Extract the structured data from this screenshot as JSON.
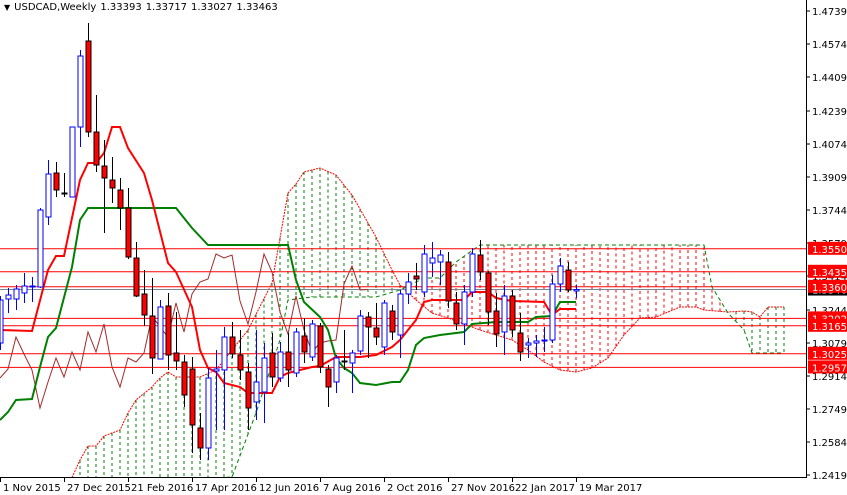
{
  "header": {
    "symbol_label": "USDCAD,Weekly",
    "open": "1.33393",
    "high": "1.33717",
    "low": "1.33027",
    "close": "1.33463"
  },
  "colors": {
    "bull": "#0000ff",
    "bear": "#ff0000",
    "tenkan": "#ff0000",
    "kijun": "#008000",
    "chikou": "#a52a2a",
    "span_a": "#ff0000",
    "span_b": "#008000",
    "level": "#ff0000",
    "current": "#778899"
  },
  "chart_data": {
    "type": "candlestick",
    "title": "USDCAD,Weekly",
    "ylim": [
      1.2419,
      1.4739
    ],
    "price_ticks": [
      "1.47390",
      "1.45740",
      "1.44090",
      "1.42390",
      "1.40740",
      "1.39090",
      "1.37440",
      "1.35790",
      "1.34140",
      "1.32440",
      "1.30790",
      "1.29140",
      "1.27490",
      "1.25840",
      "1.24190"
    ],
    "date_ticks": [
      {
        "bar": 0,
        "label": "1 Nov 2015"
      },
      {
        "bar": 8,
        "label": "27 Dec 2015"
      },
      {
        "bar": 16,
        "label": "21 Feb 2016"
      },
      {
        "bar": 24,
        "label": "17 Apr 2016"
      },
      {
        "bar": 32,
        "label": "12 Jun 2016"
      },
      {
        "bar": 40,
        "label": "7 Aug 2016"
      },
      {
        "bar": 48,
        "label": "2 Oct 2016"
      },
      {
        "bar": 56,
        "label": "27 Nov 2016"
      },
      {
        "bar": 64,
        "label": "22 Jan 2017"
      },
      {
        "bar": 72,
        "label": "19 Mar 2017"
      }
    ],
    "candles_ohlc": [
      [
        1.3079,
        1.3314,
        1.3044,
        1.3294
      ],
      [
        1.3299,
        1.3354,
        1.3229,
        1.3319
      ],
      [
        1.3299,
        1.3369,
        1.3244,
        1.3349
      ],
      [
        1.3329,
        1.3429,
        1.3279,
        1.3364
      ],
      [
        1.3359,
        1.3409,
        1.3284,
        1.3364
      ],
      [
        1.3359,
        1.3754,
        1.3354,
        1.3744
      ],
      [
        1.3709,
        1.3994,
        1.3669,
        1.3924
      ],
      [
        1.3929,
        1.3984,
        1.3809,
        1.3844
      ],
      [
        1.3829,
        1.3929,
        1.3809,
        1.3824
      ],
      [
        1.3809,
        1.4159,
        1.3809,
        1.4159
      ],
      [
        1.4159,
        1.4544,
        1.4059,
        1.4514
      ],
      [
        1.4589,
        1.4679,
        1.4109,
        1.4134
      ],
      [
        1.4134,
        1.4319,
        1.3934,
        1.3969
      ],
      [
        1.3964,
        1.4094,
        1.3629,
        1.3904
      ],
      [
        1.3894,
        1.4009,
        1.3779,
        1.3854
      ],
      [
        1.3844,
        1.3904,
        1.3644,
        1.3754
      ],
      [
        1.3754,
        1.3854,
        1.3499,
        1.3509
      ],
      [
        1.3504,
        1.3584,
        1.3309,
        1.3314
      ],
      [
        1.3324,
        1.3444,
        1.3164,
        1.3219
      ],
      [
        1.3214,
        1.3404,
        1.2924,
        1.3004
      ],
      [
        1.2999,
        1.3294,
        1.2999,
        1.3259
      ],
      [
        1.3264,
        1.3329,
        1.2944,
        1.3019
      ],
      [
        1.3029,
        1.3234,
        1.2944,
        1.2989
      ],
      [
        1.2984,
        1.3019,
        1.2759,
        1.2819
      ],
      [
        1.2949,
        1.3009,
        1.2529,
        1.2669
      ],
      [
        1.2654,
        1.2729,
        1.2494,
        1.2554
      ],
      [
        1.2554,
        1.2954,
        1.2494,
        1.2904
      ],
      [
        1.2939,
        1.3044,
        1.2644,
        1.2949
      ],
      [
        1.2944,
        1.3159,
        1.2644,
        1.3109
      ],
      [
        1.3109,
        1.3184,
        1.3004,
        1.3024
      ],
      [
        1.3019,
        1.3144,
        1.2894,
        1.2944
      ],
      [
        1.2934,
        1.2979,
        1.2644,
        1.2754
      ],
      [
        1.2784,
        1.3144,
        1.2694,
        1.2884
      ],
      [
        1.2834,
        1.3079,
        1.2679,
        1.3004
      ],
      [
        1.3029,
        1.3129,
        1.2859,
        1.2909
      ],
      [
        1.2904,
        1.3084,
        1.2884,
        1.3034
      ],
      [
        1.3034,
        1.3129,
        1.2859,
        1.2944
      ],
      [
        1.2929,
        1.3154,
        1.2909,
        1.3134
      ],
      [
        1.3114,
        1.3204,
        1.2979,
        1.3034
      ],
      [
        1.3009,
        1.3194,
        1.2989,
        1.3174
      ],
      [
        1.3164,
        1.3179,
        1.2929,
        1.2959
      ],
      [
        1.2949,
        1.2969,
        1.2759,
        1.2859
      ],
      [
        1.2884,
        1.3019,
        1.2829,
        1.3004
      ],
      [
        1.2989,
        1.3144,
        1.2944,
        1.2984
      ],
      [
        1.2979,
        1.3044,
        1.2829,
        1.3029
      ],
      [
        1.3039,
        1.3244,
        1.3019,
        1.3214
      ],
      [
        1.3209,
        1.3234,
        1.3004,
        1.3159
      ],
      [
        1.3154,
        1.3279,
        1.3069,
        1.3109
      ],
      [
        1.3059,
        1.3294,
        1.3019,
        1.3279
      ],
      [
        1.3239,
        1.3269,
        1.3094,
        1.3134
      ],
      [
        1.3119,
        1.3344,
        1.3004,
        1.3324
      ],
      [
        1.3324,
        1.3429,
        1.3274,
        1.3384
      ],
      [
        1.3414,
        1.3479,
        1.3344,
        1.3399
      ],
      [
        1.3334,
        1.3569,
        1.3309,
        1.3524
      ],
      [
        1.3479,
        1.3584,
        1.3409,
        1.3504
      ],
      [
        1.3484,
        1.3544,
        1.3369,
        1.3519
      ],
      [
        1.3484,
        1.3534,
        1.3254,
        1.3289
      ],
      [
        1.3279,
        1.3334,
        1.3144,
        1.3174
      ],
      [
        1.3174,
        1.3369,
        1.3069,
        1.3334
      ],
      [
        1.3334,
        1.3554,
        1.3309,
        1.3524
      ],
      [
        1.3519,
        1.3594,
        1.3394,
        1.3434
      ],
      [
        1.3429,
        1.3439,
        1.3169,
        1.3234
      ],
      [
        1.3239,
        1.3329,
        1.3059,
        1.3124
      ],
      [
        1.3134,
        1.3369,
        1.3019,
        1.3314
      ],
      [
        1.3314,
        1.3344,
        1.3109,
        1.3144
      ],
      [
        1.3129,
        1.3229,
        1.2989,
        1.3034
      ],
      [
        1.3069,
        1.3104,
        1.3004,
        1.3079
      ],
      [
        1.3079,
        1.3119,
        1.3009,
        1.3089
      ],
      [
        1.3089,
        1.3159,
        1.3034,
        1.3094
      ],
      [
        1.3094,
        1.3419,
        1.3079,
        1.3374
      ],
      [
        1.3374,
        1.3504,
        1.3334,
        1.3464
      ],
      [
        1.3444,
        1.3484,
        1.3334,
        1.3344
      ],
      [
        1.33393,
        1.33717,
        1.33027,
        1.33463
      ]
    ],
    "tenkan": [
      [
        0,
        1.3144
      ],
      [
        4,
        1.3139
      ],
      [
        6,
        1.3444
      ],
      [
        7,
        1.3514
      ],
      [
        8,
        1.3514
      ],
      [
        10,
        1.3894
      ],
      [
        11,
        1.3979
      ],
      [
        12,
        1.3979
      ],
      [
        13,
        1.4029
      ],
      [
        14,
        1.4159
      ],
      [
        15,
        1.4159
      ],
      [
        16,
        1.4054
      ],
      [
        18,
        1.3929
      ],
      [
        19,
        1.3794
      ],
      [
        21,
        1.3479
      ],
      [
        22,
        1.3434
      ],
      [
        24,
        1.3259
      ],
      [
        25,
        1.3044
      ],
      [
        26,
        1.2954
      ],
      [
        27,
        1.2934
      ],
      [
        28,
        1.2879
      ],
      [
        30,
        1.2859
      ],
      [
        31,
        1.2829
      ],
      [
        34,
        1.2829
      ],
      [
        35,
        1.2909
      ],
      [
        36,
        1.2929
      ],
      [
        39,
        1.2959
      ],
      [
        40,
        1.2964
      ],
      [
        42,
        1.3009
      ],
      [
        45,
        1.3009
      ],
      [
        47,
        1.3019
      ],
      [
        49,
        1.3059
      ],
      [
        50,
        1.3094
      ],
      [
        51,
        1.3144
      ],
      [
        52,
        1.3194
      ],
      [
        53,
        1.3284
      ],
      [
        54,
        1.3294
      ],
      [
        58,
        1.3294
      ],
      [
        59,
        1.3334
      ],
      [
        61,
        1.3334
      ],
      [
        62,
        1.3304
      ],
      [
        64,
        1.3289
      ],
      [
        68,
        1.3284
      ],
      [
        69,
        1.3219
      ],
      [
        70,
        1.3249
      ],
      [
        72,
        1.3249
      ]
    ],
    "kijun": [
      [
        0,
        1.2694
      ],
      [
        1,
        1.2734
      ],
      [
        2,
        1.2794
      ],
      [
        4,
        1.2799
      ],
      [
        5,
        1.2959
      ],
      [
        6,
        1.3109
      ],
      [
        7,
        1.3154
      ],
      [
        9,
        1.3459
      ],
      [
        10,
        1.3694
      ],
      [
        11,
        1.3754
      ],
      [
        22,
        1.3754
      ],
      [
        24,
        1.3654
      ],
      [
        26,
        1.3569
      ],
      [
        36,
        1.3569
      ],
      [
        37,
        1.3394
      ],
      [
        38,
        1.3284
      ],
      [
        40,
        1.3209
      ],
      [
        41,
        1.3144
      ],
      [
        42,
        1.3004
      ],
      [
        43,
        1.2954
      ],
      [
        44,
        1.2929
      ],
      [
        45,
        1.2879
      ],
      [
        47,
        1.2869
      ],
      [
        49,
        1.2884
      ],
      [
        50,
        1.2884
      ],
      [
        51,
        1.2944
      ],
      [
        52,
        1.3069
      ],
      [
        53,
        1.3104
      ],
      [
        55,
        1.3119
      ],
      [
        58,
        1.3134
      ],
      [
        59,
        1.3174
      ],
      [
        62,
        1.3184
      ],
      [
        66,
        1.3184
      ],
      [
        67,
        1.3209
      ],
      [
        69,
        1.3214
      ],
      [
        70,
        1.3284
      ],
      [
        72,
        1.3284
      ]
    ],
    "chikou_shift": 26,
    "senkou_a": [
      [
        9,
        1.2394
      ],
      [
        10,
        1.2494
      ],
      [
        11,
        1.2564
      ],
      [
        12,
        1.2564
      ],
      [
        13,
        1.2614
      ],
      [
        15,
        1.2644
      ],
      [
        16,
        1.2729
      ],
      [
        17,
        1.2794
      ],
      [
        19,
        1.2859
      ],
      [
        20,
        1.2904
      ],
      [
        21,
        1.2934
      ],
      [
        22,
        1.2909
      ],
      [
        25,
        1.2909
      ],
      [
        27,
        1.2944
      ],
      [
        31,
        1.3144
      ],
      [
        34,
        1.3379
      ],
      [
        36,
        1.3829
      ],
      [
        37,
        1.3874
      ],
      [
        38,
        1.3934
      ],
      [
        40,
        1.3954
      ],
      [
        42,
        1.3919
      ],
      [
        44,
        1.3819
      ],
      [
        47,
        1.3609
      ],
      [
        49,
        1.3444
      ],
      [
        50,
        1.3369
      ],
      [
        52,
        1.3294
      ],
      [
        54,
        1.3229
      ],
      [
        56,
        1.3204
      ],
      [
        60,
        1.3144
      ],
      [
        64,
        1.3094
      ],
      [
        66,
        1.3044
      ],
      [
        68,
        1.2984
      ],
      [
        70,
        1.2944
      ],
      [
        72,
        1.2934
      ],
      [
        74,
        1.2954
      ],
      [
        76,
        1.3004
      ],
      [
        78,
        1.3119
      ],
      [
        80,
        1.3204
      ],
      [
        82,
        1.3209
      ],
      [
        85,
        1.3259
      ],
      [
        87,
        1.3259
      ],
      [
        88,
        1.3244
      ],
      [
        91,
        1.3234
      ],
      [
        93,
        1.3239
      ],
      [
        94,
        1.3234
      ],
      [
        95,
        1.3209
      ],
      [
        96,
        1.3259
      ],
      [
        98,
        1.3259
      ]
    ],
    "senkou_b": [
      [
        9,
        1.2
      ],
      [
        28,
        1.21
      ],
      [
        29,
        1.2409
      ],
      [
        32,
        1.2729
      ],
      [
        35,
        1.3094
      ],
      [
        36,
        1.3294
      ],
      [
        39,
        1.3309
      ],
      [
        47,
        1.3309
      ],
      [
        50,
        1.3344
      ],
      [
        53,
        1.3404
      ],
      [
        55,
        1.3404
      ],
      [
        57,
        1.3484
      ],
      [
        60,
        1.3569
      ],
      [
        88,
        1.3569
      ],
      [
        89,
        1.3359
      ],
      [
        91,
        1.3229
      ],
      [
        93,
        1.3144
      ],
      [
        94,
        1.3029
      ],
      [
        98,
        1.3029
      ]
    ],
    "levels": [
      {
        "price": 1.355,
        "label": "1.35500"
      },
      {
        "price": 1.3435,
        "label": "1.34350"
      },
      {
        "price": 1.336,
        "label": "1.33600"
      },
      {
        "price": 1.3202,
        "label": "1.32020"
      },
      {
        "price": 1.3165,
        "label": "1.31650"
      },
      {
        "price": 1.3025,
        "label": "1.30250"
      },
      {
        "price": 1.2957,
        "label": "1.29570"
      }
    ],
    "current_price": {
      "price": 1.33463,
      "label": "1.33463"
    }
  }
}
